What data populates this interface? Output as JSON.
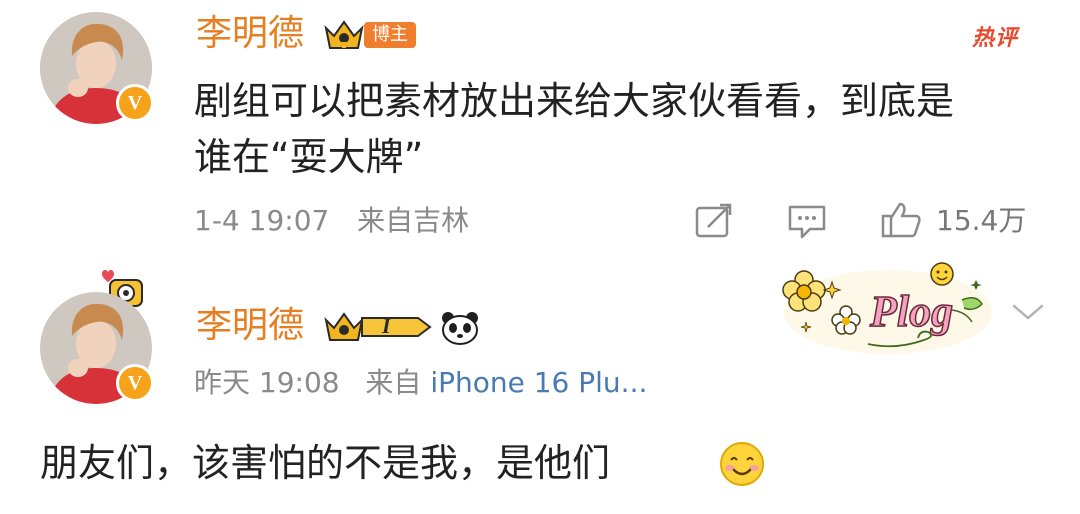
{
  "comments": [
    {
      "username": "李明德",
      "badge_label": "博主",
      "hot_label": "热评",
      "text_line1": "剧组可以把素材放出来给大家伙看看，到底是",
      "text_line2": "谁在“耍大牌”",
      "date": "1-4 19:07",
      "source": "来自吉林",
      "likes": "15.4万"
    },
    {
      "username": "李明德",
      "level_label": "I",
      "time": "昨天 19:08",
      "source_prefix": "来自",
      "source_device": "iPhone 16 Plu...",
      "text": "朋友们，该害怕的不是我，是他们",
      "sticker_text": "Plog"
    }
  ],
  "colors": {
    "username": "#e67e22",
    "link": "#4a7ab3",
    "meta": "#8a8a8a",
    "hot": "#e8492f",
    "badge": "#f07f2d",
    "verified": "#f6a21a"
  },
  "icons": [
    "verified-v-icon",
    "crown-icon",
    "repost-icon",
    "comment-icon",
    "like-icon",
    "panda-icon",
    "chevron-down-icon",
    "smile-emoji-icon",
    "camera-icon"
  ]
}
